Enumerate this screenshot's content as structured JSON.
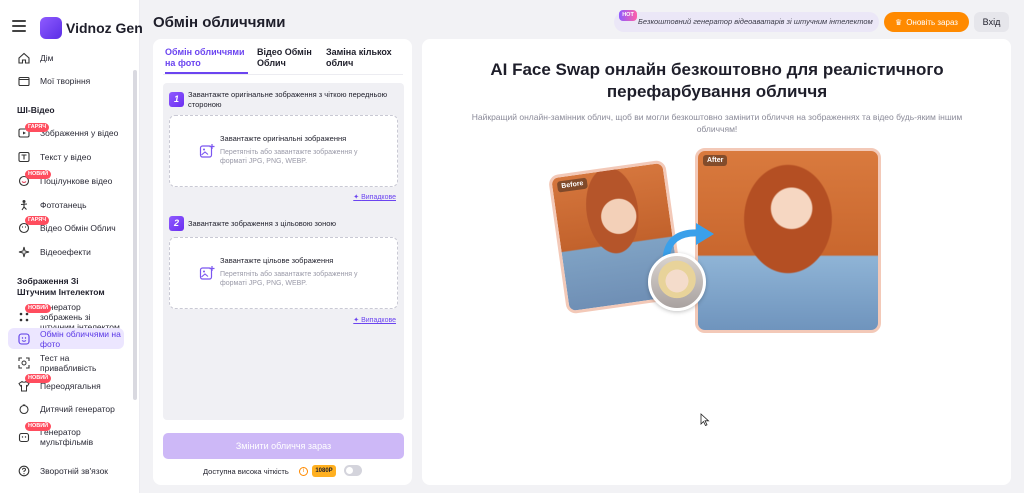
{
  "app": {
    "logo_text": "Vidnoz Gen"
  },
  "sidebar": {
    "items_top": [
      {
        "label": "Дім"
      },
      {
        "label": "Мої творіння"
      }
    ],
    "section_video": "ШІ-Відео",
    "video_items": [
      {
        "label": "Зображення у відео",
        "badge": "ГАРЯЧ"
      },
      {
        "label": "Текст у відео"
      },
      {
        "label": "Поцілункове відео",
        "badge": "НОВИЙ"
      },
      {
        "label": "Фототанець"
      },
      {
        "label": "Відео Обмін Облич",
        "badge": "ГАРЯЧ"
      },
      {
        "label": "Відеоефекти"
      }
    ],
    "section_image": "Зображення Зі Штучним Інтелектом",
    "image_items": [
      {
        "label": "Генератор зображень зі штучним інтелектом",
        "badge": "НОВИЙ"
      },
      {
        "label": "Обмін обличчями на фото"
      },
      {
        "label": "Тест на привабливість"
      },
      {
        "label": "Переодягальня",
        "badge": "НОВИЙ"
      },
      {
        "label": "Дитячий генератор"
      },
      {
        "label": "Генератор мультфільмів",
        "badge": "НОВИЙ"
      }
    ],
    "feedback": "Зворотній зв'язок"
  },
  "header": {
    "title": "Обмін обличчями",
    "promo_tag": "HOT",
    "promo_text": "Безкоштовний генератор відеоаватарів зі штучним інтелектом",
    "upgrade_label": "Оновіть зараз",
    "login_label": "Вхід"
  },
  "left_panel": {
    "tabs": [
      {
        "label": "Обмін обличчями на фото"
      },
      {
        "label": "Відео Обмін Облич"
      },
      {
        "label": "Заміна кількох облич"
      }
    ],
    "step1": {
      "num": "1",
      "title": "Завантажте оригінальне зображення з чіткою передньою стороною",
      "drop_title": "Завантажте оригінальні зображення",
      "drop_desc": "Перетягніть або завантажте зображення у форматі JPG, PNG, WEBP.",
      "example_label": "Випадкове"
    },
    "step2": {
      "num": "2",
      "title": "Завантажте зображення з цільовою зоною",
      "drop_title": "Завантажте цільове зображення",
      "drop_desc": "Перетягніть або завантажте зображення у форматі JPG, PNG, WEBP.",
      "example_label": "Випадкове"
    },
    "cta_label": "Змінити обличчя зараз",
    "hq_label": "Доступна висока чіткість",
    "hd_badge": "1080P"
  },
  "hero": {
    "title": "AI Face Swap онлайн безкоштовно для реалістичного перефарбування обличчя",
    "subtitle": "Найкращий онлайн-замінник облич, щоб ви могли безкоштовно замінити обличчя на зображеннях та відео будь-яким іншим обличчям!",
    "before_label": "Before",
    "after_label": "After"
  },
  "colors": {
    "accent": "#6b44f0",
    "upgrade": "#ff8a00",
    "badge": "#ff4d5e"
  }
}
